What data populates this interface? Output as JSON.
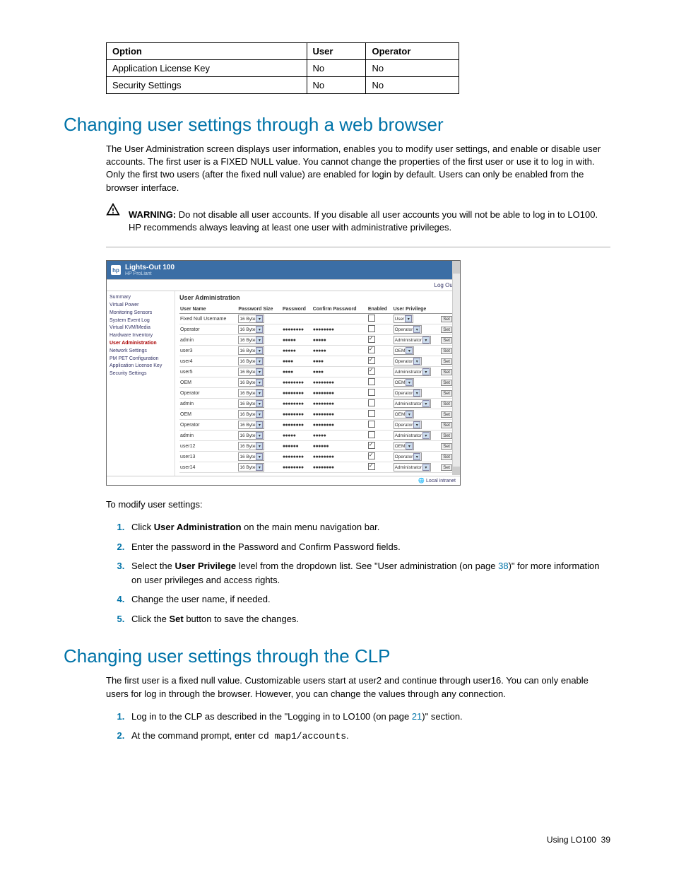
{
  "options_table": {
    "headers": [
      "Option",
      "User",
      "Operator"
    ],
    "rows": [
      [
        "Application License Key",
        "No",
        "No"
      ],
      [
        "Security Settings",
        "No",
        "No"
      ]
    ]
  },
  "section1": {
    "title": "Changing user settings through a web browser",
    "para": "The User Administration screen displays user information, enables you to modify user settings, and enable or disable user accounts. The first user is a FIXED NULL value. You cannot change the properties of the first user or use it to log in with. Only the first two users (after the fixed null value) are enabled for login by default. Users can only be enabled from the browser interface.",
    "warning_label": "WARNING:",
    "warning_text": "  Do not disable all user accounts. If you disable all user accounts you will not be able to log in to LO100. HP recommends always leaving at least one user with administrative privileges."
  },
  "screenshot": {
    "brand": "Lights-Out 100",
    "brand_sub": "HP ProLiant",
    "logout": "Log Out",
    "nav": [
      {
        "label": "Summary",
        "active": false
      },
      {
        "label": "Virtual Power",
        "active": false
      },
      {
        "label": "Monitoring Sensors",
        "active": false
      },
      {
        "label": "System Event Log",
        "active": false
      },
      {
        "label": "Virtual KVM/Media",
        "active": false
      },
      {
        "label": "Hardware Inventory",
        "active": false
      },
      {
        "label": "User Administration",
        "active": true
      },
      {
        "label": "Network Settings",
        "active": false
      },
      {
        "label": "PM PET Configuration",
        "active": false
      },
      {
        "label": "Application License Key",
        "active": false
      },
      {
        "label": "Security Settings",
        "active": false
      }
    ],
    "panel_title": "User Administration",
    "cols": [
      "User Name",
      "Password Size",
      "Password",
      "Confirm Password",
      "Enabled",
      "User Privilege",
      ""
    ],
    "rows": [
      {
        "name": "Fixed Null Username",
        "size": "16 Byte",
        "pwd": "",
        "cpwd": "",
        "enabled": false,
        "priv": "User"
      },
      {
        "name": "Operator",
        "size": "16 Byte",
        "pwd": "●●●●●●●●",
        "cpwd": "●●●●●●●●",
        "enabled": false,
        "priv": "Operator"
      },
      {
        "name": "admin",
        "size": "16 Byte",
        "pwd": "●●●●●",
        "cpwd": "●●●●●",
        "enabled": true,
        "priv": "Administrator"
      },
      {
        "name": "user3",
        "size": "16 Byte",
        "pwd": "●●●●●",
        "cpwd": "●●●●●",
        "enabled": true,
        "priv": "OEM"
      },
      {
        "name": "user4",
        "size": "16 Byte",
        "pwd": "●●●●",
        "cpwd": "●●●●",
        "enabled": true,
        "priv": "Operator"
      },
      {
        "name": "user5",
        "size": "16 Byte",
        "pwd": "●●●●",
        "cpwd": "●●●●",
        "enabled": true,
        "priv": "Administrator"
      },
      {
        "name": "OEM",
        "size": "16 Byte",
        "pwd": "●●●●●●●●",
        "cpwd": "●●●●●●●●",
        "enabled": false,
        "priv": "OEM"
      },
      {
        "name": "Operator",
        "size": "16 Byte",
        "pwd": "●●●●●●●●",
        "cpwd": "●●●●●●●●",
        "enabled": false,
        "priv": "Operator"
      },
      {
        "name": "admin",
        "size": "16 Byte",
        "pwd": "●●●●●●●●",
        "cpwd": "●●●●●●●●",
        "enabled": false,
        "priv": "Administrator"
      },
      {
        "name": "OEM",
        "size": "16 Byte",
        "pwd": "●●●●●●●●",
        "cpwd": "●●●●●●●●",
        "enabled": false,
        "priv": "OEM"
      },
      {
        "name": "Operator",
        "size": "16 Byte",
        "pwd": "●●●●●●●●",
        "cpwd": "●●●●●●●●",
        "enabled": false,
        "priv": "Operator"
      },
      {
        "name": "admin",
        "size": "16 Byte",
        "pwd": "●●●●●",
        "cpwd": "●●●●●",
        "enabled": false,
        "priv": "Administrator"
      },
      {
        "name": "user12",
        "size": "16 Byte",
        "pwd": "●●●●●●",
        "cpwd": "●●●●●●",
        "enabled": true,
        "priv": "OEM"
      },
      {
        "name": "user13",
        "size": "16 Byte",
        "pwd": "●●●●●●●●",
        "cpwd": "●●●●●●●●",
        "enabled": true,
        "priv": "Operator"
      },
      {
        "name": "user14",
        "size": "16 Byte",
        "pwd": "●●●●●●●●",
        "cpwd": "●●●●●●●●",
        "enabled": true,
        "priv": "Administrator"
      }
    ],
    "set_label": "Set",
    "footer": "Local intranet"
  },
  "after_ss_intro": "To modify user settings:",
  "steps1": {
    "s1a": "Click ",
    "s1b": "User Administration",
    "s1c": " on the main menu navigation bar.",
    "s2": "Enter the password in the Password and Confirm Password fields.",
    "s3a": "Select the ",
    "s3b": "User Privilege",
    "s3c": " level from the dropdown list. See \"User administration (on page ",
    "s3d": "38",
    "s3e": ")\" for more information on user privileges and access rights.",
    "s4": "Change the user name, if needed.",
    "s5a": "Click the ",
    "s5b": "Set",
    "s5c": " button to save the changes."
  },
  "section2": {
    "title": "Changing user settings through the CLP",
    "para": "The first user is a fixed null value. Customizable users start at user2 and continue through user16. You can only enable users for log in through the browser. However, you can change the values through any connection."
  },
  "steps2": {
    "s1a": "Log in to the CLP as described in the \"Logging in to LO100 (on page ",
    "s1b": "21",
    "s1c": ")\" section.",
    "s2a": "At the command prompt, enter ",
    "s2b": "cd map1/accounts",
    "s2c": "."
  },
  "footer": {
    "text": "Using LO100",
    "page": "39"
  }
}
